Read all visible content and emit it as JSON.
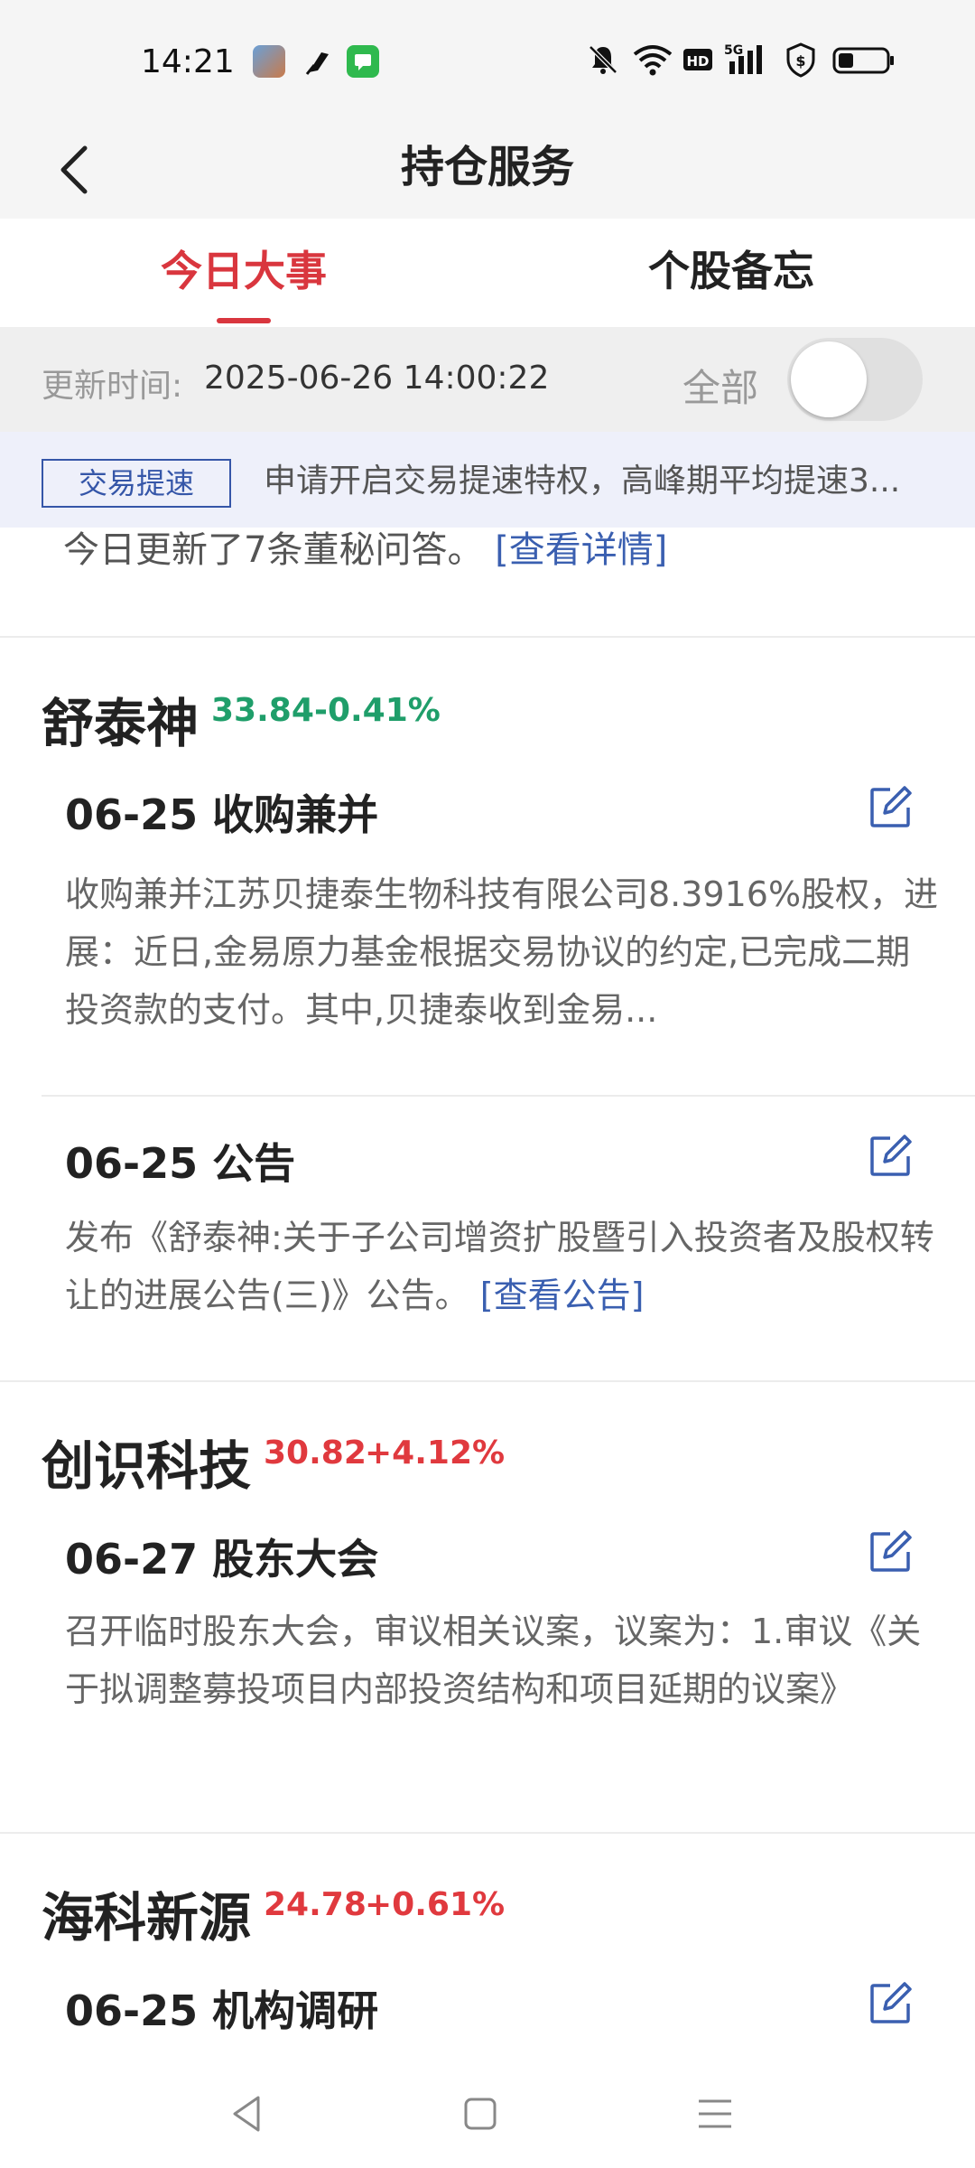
{
  "status_bar": {
    "time": "14:21",
    "icons": [
      "gallery-app-icon",
      "feather-app-icon",
      "messages-app-icon",
      "bell-muted-icon",
      "wifi-icon",
      "hd-icon",
      "signal-5g-icon",
      "vpn-shield-icon",
      "battery-icon"
    ],
    "signal_text": "5G",
    "hd_text": "HD"
  },
  "header": {
    "title": "持仓服务"
  },
  "tabs": [
    {
      "label": "今日大事",
      "active": true
    },
    {
      "label": "个股备忘",
      "active": false
    }
  ],
  "update": {
    "label": "更新时间:",
    "time": "2025-06-26 14:00:22",
    "filter_label": "全部",
    "toggle_on": false
  },
  "promo": {
    "badge": "交易提速",
    "text": "申请开启交易提速特权，高峰期平均提速3..."
  },
  "partial_item": {
    "text": "今日更新了7条董秘问答。",
    "link": "[查看详情]"
  },
  "stocks": [
    {
      "name": "舒泰神",
      "price": "33.84",
      "change": "-0.41%",
      "color": "#1f9e6a",
      "events": [
        {
          "title": "06-25 收购兼并",
          "body": "收购兼并江苏贝捷泰生物科技有限公司8.3916%股权，进展：近日,金易原力基金根据交易协议的约定,已完成二期投资款的支付。其中,贝捷泰收到金易..."
        },
        {
          "title": "06-25 公告",
          "body": "发布《舒泰神:关于子公司增资扩股暨引入投资者及股权转让的进展公告(三)》公告。",
          "link": "[查看公告]"
        }
      ]
    },
    {
      "name": "创识科技",
      "price": "30.82",
      "change": "+4.12%",
      "color": "#e0393e",
      "events": [
        {
          "title": "06-27 股东大会",
          "body": "召开临时股东大会，审议相关议案，议案为：1.审议《关于拟调整募投项目内部投资结构和项目延期的议案》"
        }
      ]
    },
    {
      "name": "海科新源",
      "price": "24.78",
      "change": "+0.61%",
      "color": "#e0393e",
      "events": [
        {
          "title": "06-25 机构调研"
        }
      ]
    }
  ],
  "nav": {
    "icons": [
      "back-triangle-icon",
      "home-square-icon",
      "menu-lines-icon"
    ]
  },
  "colors": {
    "accent": "#d9363e",
    "link": "#3a5fb0",
    "down": "#1f9e6a",
    "up": "#e0393e"
  }
}
